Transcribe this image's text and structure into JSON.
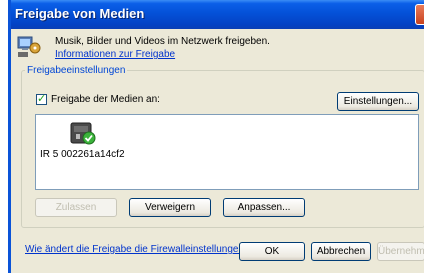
{
  "window": {
    "title": "Freigabe von Medien"
  },
  "header": {
    "description": "Musik, Bilder und Videos im Netzwerk freigeben.",
    "info_link": "Informationen zur Freigabe"
  },
  "settings_group": {
    "label": "Freigabeeinstellungen",
    "share_checkbox_label": "Freigabe der Medien an:",
    "share_checked": true,
    "settings_button": "Einstellungen..."
  },
  "device_list": {
    "items": [
      {
        "label": "IR 5 002261a14cf2",
        "icon": "media-device-icon"
      }
    ]
  },
  "device_actions": {
    "allow": "Zulassen",
    "deny": "Verweigern",
    "customize": "Anpassen..."
  },
  "footer": {
    "firewall_link": "Wie ändert die Freigabe die Firewalleinstellungen?",
    "ok": "OK",
    "cancel": "Abbrechen",
    "apply": "Übernehmen"
  },
  "colors": {
    "titlebar": "#0451d8",
    "dialog_bg": "#ece9d8",
    "link": "#0033cc",
    "group_label": "#0046d5"
  }
}
